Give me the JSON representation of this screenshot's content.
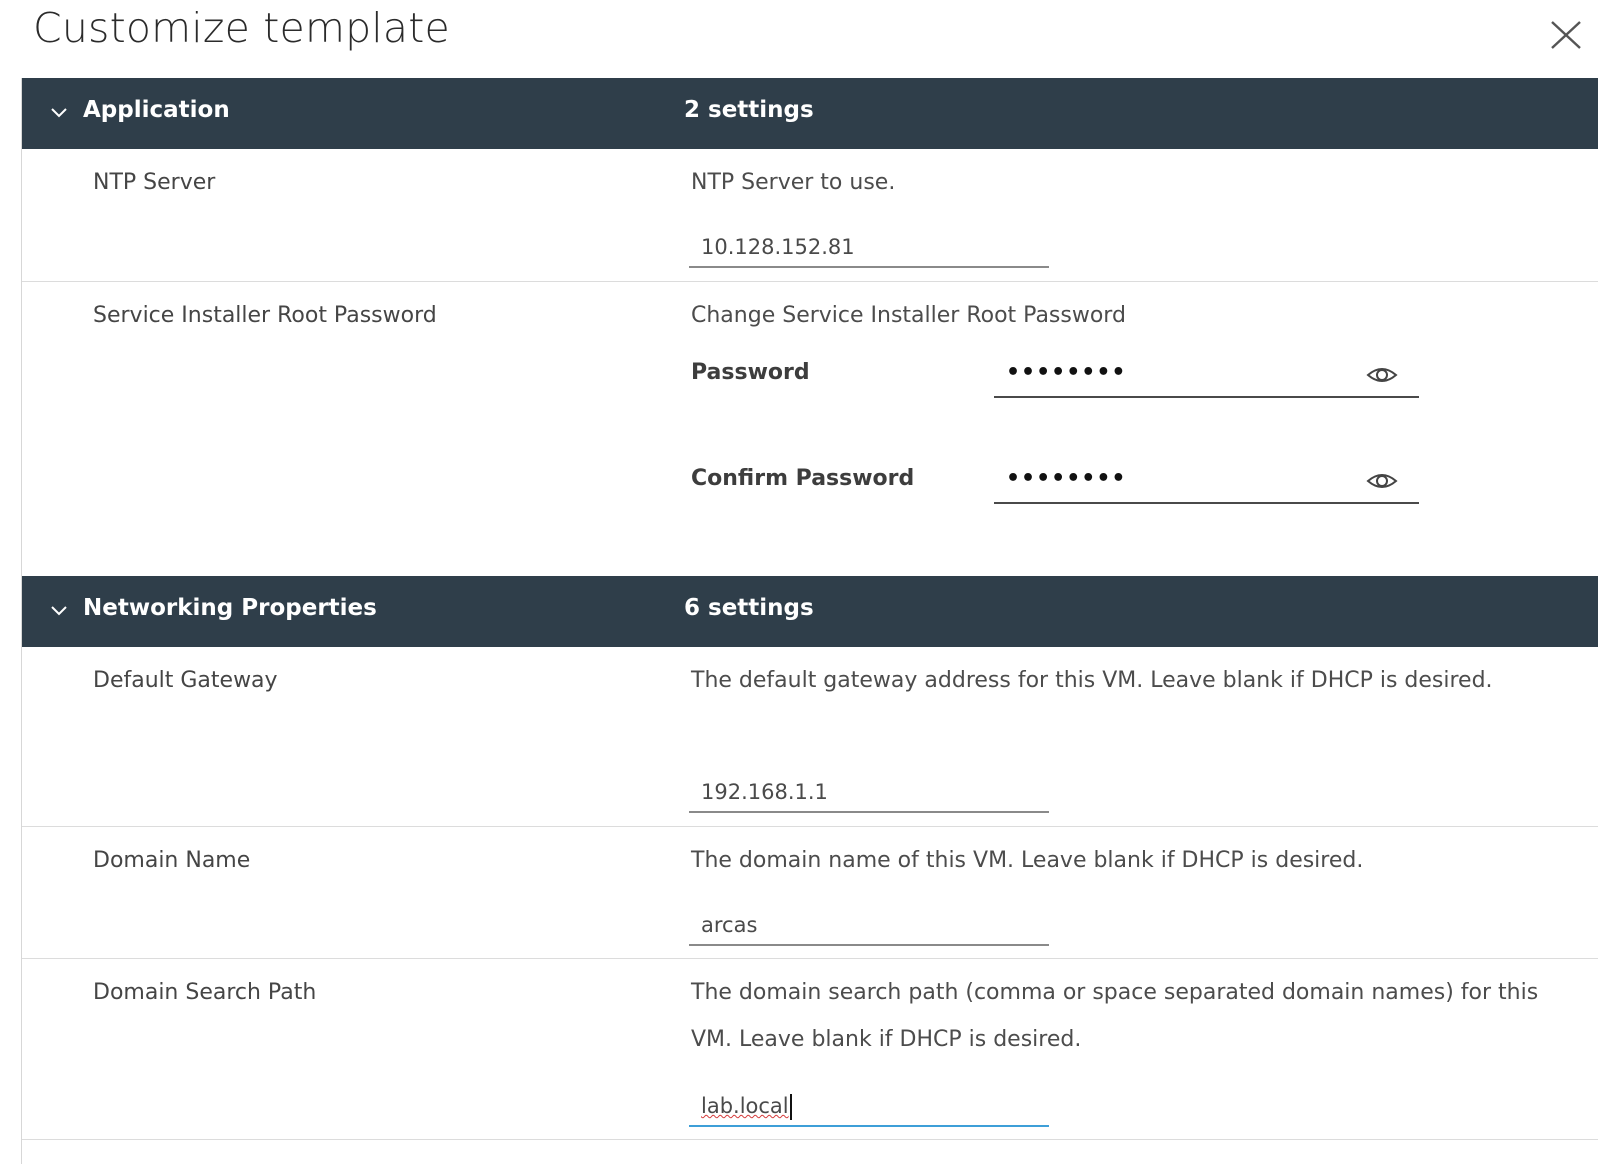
{
  "dialog": {
    "title": "Customize template"
  },
  "sections": [
    {
      "title": "Application",
      "count": "2 settings",
      "rows": [
        {
          "label": "NTP Server",
          "description": "NTP Server to use.",
          "value": "10.128.152.81"
        },
        {
          "label": "Service Installer Root Password",
          "description": "Change Service Installer Root Password",
          "password_label": "Password",
          "password_value": "••••••••",
          "confirm_label": "Confirm Password",
          "confirm_value": "••••••••"
        }
      ]
    },
    {
      "title": "Networking Properties",
      "count": "6 settings",
      "rows": [
        {
          "label": "Default Gateway",
          "description": "The default gateway address for this VM. Leave blank if DHCP is desired.",
          "value": "192.168.1.1"
        },
        {
          "label": "Domain Name",
          "description": "The domain name of this VM. Leave blank if DHCP is desired.",
          "value": "arcas"
        },
        {
          "label": "Domain Search Path",
          "description": "The domain search path (comma or space separated domain names) for this VM. Leave blank if DHCP is desired.",
          "value": "lab.local"
        }
      ]
    }
  ],
  "icons": {
    "close": "close-icon",
    "chevron": "chevron-down-icon",
    "eye": "eye-icon"
  },
  "colors": {
    "section_header_bg": "#2f3e4a",
    "focus_underline": "#3e9fd8"
  }
}
